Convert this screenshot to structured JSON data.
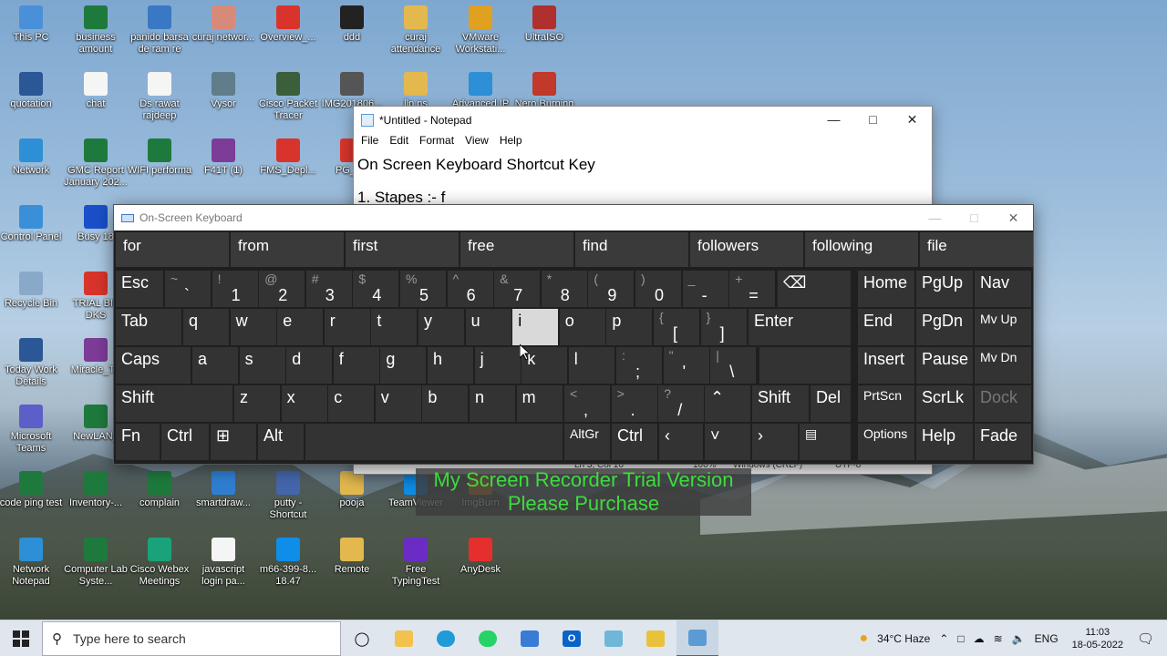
{
  "desktop": {
    "icons": [
      {
        "label": "This PC",
        "icon": "pc-icon",
        "color": "#4a90d9"
      },
      {
        "label": "business amount",
        "icon": "excel-icon",
        "color": "#1e7a3c"
      },
      {
        "label": "panido barsa de ram re",
        "icon": "doc-icon",
        "color": "#3b78c4"
      },
      {
        "label": "curaj networ...",
        "icon": "image-icon",
        "color": "#d88a7a"
      },
      {
        "label": "Overview_...",
        "icon": "pdf-icon",
        "color": "#d9342b"
      },
      {
        "label": "ddd",
        "icon": "video-icon",
        "color": "#222222"
      },
      {
        "label": "curaj attendance",
        "icon": "zip-icon",
        "color": "#e3b94f"
      },
      {
        "label": "VMware Workstati...",
        "icon": "vmware-icon",
        "color": "#e0a020"
      },
      {
        "label": "UltraISO",
        "icon": "disc-icon",
        "color": "#b03030"
      },
      {
        "label": "quotation",
        "icon": "word-icon",
        "color": "#2b5797"
      },
      {
        "label": "chat",
        "icon": "text-icon",
        "color": "#f5f5f5"
      },
      {
        "label": "Ds rawat rajdeep",
        "icon": "file-icon",
        "color": "#f5f5f5"
      },
      {
        "label": "Vysor",
        "icon": "vysor-icon",
        "color": "#607d8b"
      },
      {
        "label": "Cisco Packet Tracer",
        "icon": "cisco-icon",
        "color": "#3b5f3b"
      },
      {
        "label": "IMG201806...",
        "icon": "phone-icon",
        "color": "#555555"
      },
      {
        "label": "llp ns",
        "icon": "zip-icon",
        "color": "#e3b94f"
      },
      {
        "label": "Advanced IP",
        "icon": "network-icon",
        "color": "#2d8fd5"
      },
      {
        "label": "Nero Burning",
        "icon": "nero-icon",
        "color": "#c0392b"
      },
      {
        "label": "Network",
        "icon": "network-icon",
        "color": "#2d8fd5"
      },
      {
        "label": "GMC Report January 202...",
        "icon": "excel-icon",
        "color": "#1e7a3c"
      },
      {
        "label": "WIFI performa",
        "icon": "excel-icon",
        "color": "#1e7a3c"
      },
      {
        "label": "F41T (1)",
        "icon": "rar-icon",
        "color": "#7d3c98"
      },
      {
        "label": "FMS_Depl...",
        "icon": "pdf-icon",
        "color": "#d9342b"
      },
      {
        "label": "PG_Up",
        "icon": "pdf-icon",
        "color": "#d9342b"
      },
      {
        "label": "Control Panel",
        "icon": "control-panel-icon",
        "color": "#3a8fd9"
      },
      {
        "label": "Busy 18",
        "icon": "busy-icon",
        "color": "#1a4fc9"
      },
      {
        "label": "Recycle Bin",
        "icon": "recycle-bin-icon",
        "color": "#8aa9c9"
      },
      {
        "label": "TRIAL BIL DKS",
        "icon": "pdf-icon",
        "color": "#d9342b"
      },
      {
        "label": "Today Work Details",
        "icon": "word-icon",
        "color": "#2b5797"
      },
      {
        "label": "Miracle_Th",
        "icon": "rar-icon",
        "color": "#7d3c98"
      },
      {
        "label": "Microsoft Teams",
        "icon": "teams-icon",
        "color": "#5b5fc7"
      },
      {
        "label": "NewLAN_",
        "icon": "excel-icon",
        "color": "#1e7a3c"
      },
      {
        "label": "code ping test",
        "icon": "excel-icon",
        "color": "#1e7a3c"
      },
      {
        "label": "Inventory-...",
        "icon": "excel-icon",
        "color": "#1e7a3c"
      },
      {
        "label": "complain",
        "icon": "excel-icon",
        "color": "#1e7a3c"
      },
      {
        "label": "smartdraw...",
        "icon": "smartdraw-icon",
        "color": "#2f7fd1"
      },
      {
        "label": "putty - Shortcut",
        "icon": "putty-icon",
        "color": "#4466aa"
      },
      {
        "label": "pooja",
        "icon": "zip-icon",
        "color": "#e3b94f"
      },
      {
        "label": "TeamViewer",
        "icon": "teamviewer-icon",
        "color": "#0e8ee9"
      },
      {
        "label": "ImgBurn",
        "icon": "imgburn-icon",
        "color": "#d88c2a"
      },
      {
        "label": "Network Notepad",
        "icon": "network-icon",
        "color": "#2d8fd5"
      },
      {
        "label": "Computer Lab Syste...",
        "icon": "excel-icon",
        "color": "#1e7a3c"
      },
      {
        "label": "Cisco Webex Meetings",
        "icon": "webex-icon",
        "color": "#1aa37a"
      },
      {
        "label": "javascript login pa...",
        "icon": "file-icon",
        "color": "#f5f5f5"
      },
      {
        "label": "m66-399-8... 18.47",
        "icon": "teamviewer-icon",
        "color": "#0e8ee9"
      },
      {
        "label": "Remote",
        "icon": "zip-icon",
        "color": "#e3b94f"
      },
      {
        "label": "Free TypingTest",
        "icon": "typing-icon",
        "color": "#6a2cc4"
      },
      {
        "label": "AnyDesk",
        "icon": "anydesk-icon",
        "color": "#e52e2e"
      }
    ]
  },
  "notepad": {
    "title": "*Untitled - Notepad",
    "menu": [
      "File",
      "Edit",
      "Format",
      "View",
      "Help"
    ],
    "line1": "On Screen Keyboard Shortcut Key",
    "line2": "1. Stapes :- f",
    "status": {
      "position": "Ln 3, Col 16",
      "zoom": "100%",
      "eol": "Windows (CRLF)",
      "encoding": "UTF-8"
    }
  },
  "osk": {
    "title": "On-Screen Keyboard",
    "predictions": [
      "for",
      "from",
      "first",
      "free",
      "find",
      "followers",
      "following",
      "file"
    ],
    "keys": {
      "esc": "Esc",
      "tab": "Tab",
      "caps": "Caps",
      "shift": "Shift",
      "fn": "Fn",
      "ctrl": "Ctrl",
      "alt": "Alt",
      "altgr": "AltGr",
      "enter": "Enter",
      "shift_r": "Shift",
      "del": "Del",
      "home": "Home",
      "pgup": "PgUp",
      "nav": "Nav",
      "end": "End",
      "pgdn": "PgDn",
      "mvup": "Mv Up",
      "insert": "Insert",
      "pause": "Pause",
      "mvdn": "Mv Dn",
      "prtscn": "PrtScn",
      "scrlk": "ScrLk",
      "dock": "Dock",
      "options": "Options",
      "help": "Help",
      "fade": "Fade"
    },
    "numrow": [
      {
        "sh": "~",
        "lo": "`"
      },
      {
        "sh": "!",
        "lo": "1"
      },
      {
        "sh": "@",
        "lo": "2"
      },
      {
        "sh": "#",
        "lo": "3"
      },
      {
        "sh": "$",
        "lo": "4"
      },
      {
        "sh": "%",
        "lo": "5"
      },
      {
        "sh": "^",
        "lo": "6"
      },
      {
        "sh": "&",
        "lo": "7"
      },
      {
        "sh": "*",
        "lo": "8"
      },
      {
        "sh": "(",
        "lo": "9"
      },
      {
        "sh": ")",
        "lo": "0"
      },
      {
        "sh": "_",
        "lo": "-"
      },
      {
        "sh": "+",
        "lo": "="
      }
    ],
    "row_q": [
      "q",
      "w",
      "e",
      "r",
      "t",
      "y",
      "u",
      "i",
      "o",
      "p"
    ],
    "row_q_sym": [
      {
        "sh": "{",
        "lo": "["
      },
      {
        "sh": "}",
        "lo": "]"
      }
    ],
    "row_a": [
      "a",
      "s",
      "d",
      "f",
      "g",
      "h",
      "j",
      "k",
      "l"
    ],
    "row_a_sym": [
      {
        "sh": ":",
        "lo": ";"
      },
      {
        "sh": "\"",
        "lo": "'"
      },
      {
        "sh": "|",
        "lo": "\\"
      }
    ],
    "row_z": [
      "z",
      "x",
      "c",
      "v",
      "b",
      "n",
      "m"
    ],
    "row_z_sym": [
      {
        "sh": "<",
        "lo": ","
      },
      {
        "sh": ">",
        "lo": "."
      },
      {
        "sh": "?",
        "lo": "/"
      }
    ],
    "pressed_key": "i"
  },
  "watermark": {
    "line1": "My Screen Recorder Trial Version",
    "line2": "Please Purchase"
  },
  "taskbar": {
    "search_placeholder": "Type here to search",
    "weather": "34°C  Haze",
    "language": "ENG",
    "time": "11:03",
    "date": "18-05-2022"
  }
}
